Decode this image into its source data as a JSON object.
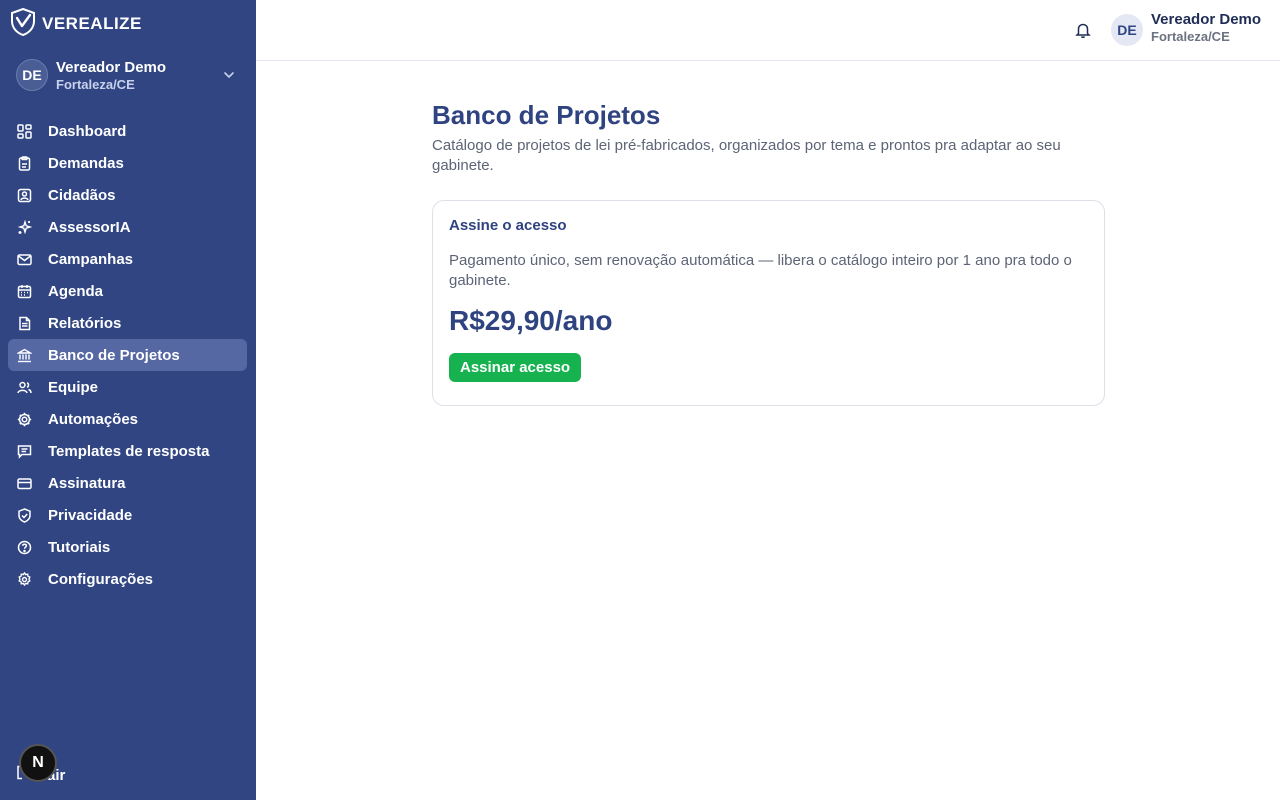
{
  "brand": {
    "name": "VEREALIZE",
    "icon": "shield-check-icon"
  },
  "sidebar": {
    "profile": {
      "initials": "DE",
      "name": "Vereador Demo",
      "location": "Fortaleza/CE"
    },
    "items": [
      {
        "label": "Dashboard",
        "icon": "grid-icon"
      },
      {
        "label": "Demandas",
        "icon": "clipboard-icon"
      },
      {
        "label": "Cidadãos",
        "icon": "contact-icon"
      },
      {
        "label": "AssessorIA",
        "icon": "sparkles-icon"
      },
      {
        "label": "Campanhas",
        "icon": "mail-icon"
      },
      {
        "label": "Agenda",
        "icon": "calendar-icon"
      },
      {
        "label": "Relatórios",
        "icon": "file-text-icon"
      },
      {
        "label": "Banco de Projetos",
        "icon": "landmark-icon",
        "active": true
      },
      {
        "label": "Equipe",
        "icon": "users-icon"
      },
      {
        "label": "Automações",
        "icon": "cog-icon"
      },
      {
        "label": "Templates de resposta",
        "icon": "message-square-icon"
      },
      {
        "label": "Assinatura",
        "icon": "credit-card-icon"
      },
      {
        "label": "Privacidade",
        "icon": "shield-icon"
      },
      {
        "label": "Tutoriais",
        "icon": "help-circle-icon"
      },
      {
        "label": "Configurações",
        "icon": "settings-icon"
      }
    ],
    "logout_label": "Sair",
    "next_badge": "N"
  },
  "topbar": {
    "initials": "DE",
    "user_name": "Vereador Demo",
    "user_location": "Fortaleza/CE"
  },
  "main": {
    "title": "Banco de Projetos",
    "description": "Catálogo de projetos de lei pré-fabricados, organizados por tema e prontos pra adaptar ao seu gabinete.",
    "card": {
      "title": "Assine o acesso",
      "description": "Pagamento único, sem renovação automática — libera o catálogo inteiro por 1 ano pra todo o gabinete.",
      "price": "R$29,90/ano",
      "cta_label": "Assinar acesso"
    }
  },
  "colors": {
    "sidebar_bg": "#304582",
    "active_item": "#5668a3",
    "accent_text": "#2f4380",
    "cta_green": "#16b24f"
  }
}
